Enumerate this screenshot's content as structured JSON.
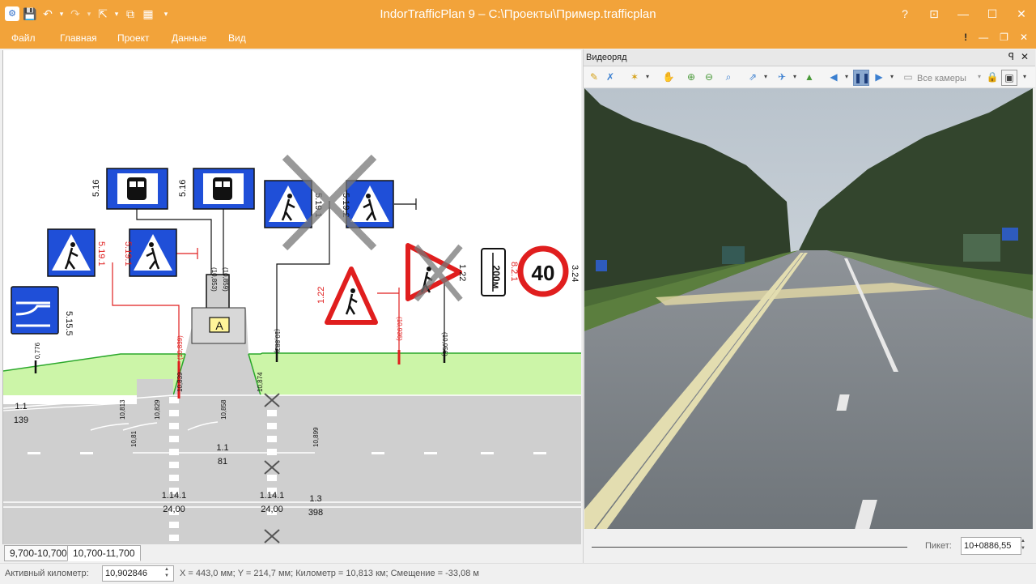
{
  "window": {
    "title": "IndorTrafficPlan 9 – C:\\Проекты\\Пример.trafficplan",
    "help": "?",
    "restore": "⊡",
    "minimize": "—",
    "maximize": "☐",
    "close": "✕"
  },
  "quick_access": {
    "app_icon": "app-logo-icon",
    "save": "💾",
    "undo": "↶",
    "redo": "↷",
    "tool1": "⇱",
    "tool2": "⧉",
    "tool3": "▦",
    "more": "▾"
  },
  "menu": {
    "items": [
      "Файл",
      "Главная",
      "Проект",
      "Данные",
      "Вид"
    ],
    "right_icons": [
      "!",
      "—",
      "❐",
      "✕"
    ]
  },
  "plan": {
    "signs": {
      "s5_15_5": "5.15.5",
      "s5_16a": "5.16",
      "s5_16b": "5.16",
      "s5_19_1a": "5.19.1",
      "s5_19_1b": "5.19.1",
      "s5_19_1c": "5.19.1",
      "s5_19_2": "5.19.2",
      "s1_22a": "1.22",
      "s1_22b": "1.22",
      "s8_2_1": "8.2.1",
      "s3_24": "3.24",
      "plate": "200м",
      "speed": "40",
      "bus_stop": "А"
    },
    "kms": {
      "k0776": "0,776",
      "k10813": "10,813",
      "k10829": "10,829",
      "k10839": "(10,839)",
      "k10839b": "10,839",
      "k10853": "(10,853)",
      "k10859": "(10,859)",
      "k10858": "10,858",
      "k10874": "10,874",
      "k10882": "(10,882)",
      "k10899": "10,899",
      "k10936": "(10,936)",
      "k10956": "(10,956)",
      "k1081": "10,81"
    },
    "markings": {
      "m1_1a": "1.1",
      "m1_1a_len": "139",
      "m1_1b": "1.1",
      "m1_1b_len": "81",
      "m1_14_1a": "1.14.1",
      "m1_14_1a_len": "24,00",
      "m1_14_1b": "1.14.1",
      "m1_14_1b_len": "24,00",
      "m1_3": "1.3",
      "m1_3_len": "398"
    }
  },
  "tabs": [
    "9,700-10,700",
    "10,700-11,700"
  ],
  "status": {
    "active_km_label": "Активный километр:",
    "active_km_value": "10,902846",
    "coords": "X = 443,0 мм; Y = 214,7 мм; Километр = 10,813 км; Смещение = -33,08 м"
  },
  "video": {
    "title": "Видеоряд",
    "pin": "ꟼ",
    "close": "✕",
    "cameras": "Все камеры",
    "picket_label": "Пикет:",
    "picket_value": "10+0886,55"
  },
  "colors": {
    "accent": "#f2a33a",
    "sign_blue": "#1f4fd8",
    "sign_red": "#e01e1e",
    "verge_green": "#ccf5a8",
    "road_gray": "#cfcfcf"
  }
}
